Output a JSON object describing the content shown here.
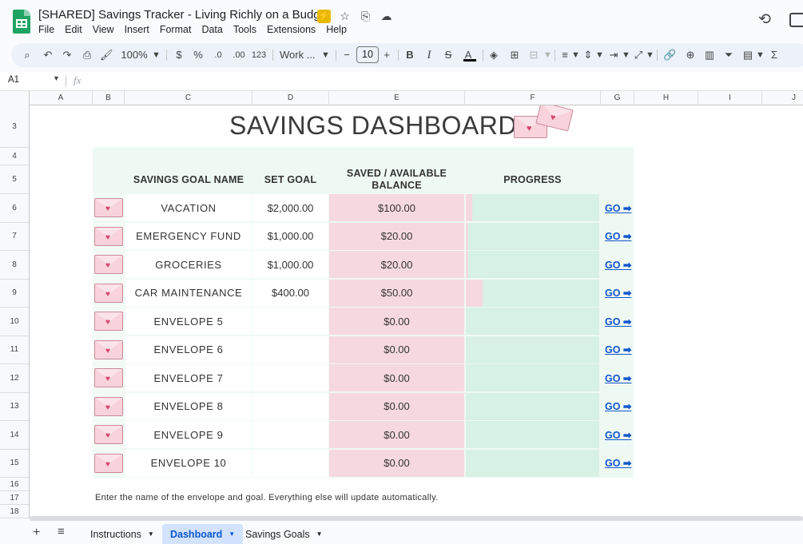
{
  "app": {
    "doc_title": "[SHARED] Savings Tracker - Living Richly on a Budget",
    "menu": [
      "File",
      "Edit",
      "View",
      "Insert",
      "Format",
      "Data",
      "Tools",
      "Extensions",
      "Help"
    ]
  },
  "toolbar": {
    "zoom": "100%",
    "currency": "$",
    "percent": "%",
    "dec_decrease": ".0",
    "dec_increase": ".00",
    "number_format": "123",
    "font": "Work ...",
    "font_size": "10",
    "minus": "−",
    "plus": "+",
    "bold": "B",
    "italic": "I",
    "strike": "S",
    "text_color": "A",
    "sigma": "Σ"
  },
  "formula_bar": {
    "cell_ref": "A1",
    "fx": "fx"
  },
  "grid": {
    "columns": [
      "A",
      "B",
      "C",
      "D",
      "E",
      "F",
      "G",
      "H",
      "I",
      "J"
    ],
    "rows": [
      "3",
      "4",
      "5",
      "6",
      "7",
      "8",
      "9",
      "10",
      "11",
      "12",
      "13",
      "14",
      "15",
      "16",
      "17",
      "18"
    ]
  },
  "dashboard": {
    "title": "SAVINGS DASHBOARD",
    "headers": {
      "name": "SAVINGS GOAL NAME",
      "goal": "SET GOAL",
      "saved": "SAVED / AVAILABLE BALANCE",
      "progress": "PROGRESS"
    },
    "rows": [
      {
        "name": "VACATION",
        "goal": "$2,000.00",
        "saved": "$100.00",
        "progress": 0.05,
        "go": "GO ➡"
      },
      {
        "name": "EMERGENCY FUND",
        "goal": "$1,000.00",
        "saved": "$20.00",
        "progress": 0.02,
        "go": "GO ➡"
      },
      {
        "name": "GROCERIES",
        "goal": "$1,000.00",
        "saved": "$20.00",
        "progress": 0.02,
        "go": "GO ➡"
      },
      {
        "name": "CAR MAINTENANCE",
        "goal": "$400.00",
        "saved": "$50.00",
        "progress": 0.125,
        "go": "GO ➡"
      },
      {
        "name": "ENVELOPE 5",
        "goal": "",
        "saved": "$0.00",
        "progress": 0,
        "go": "GO ➡"
      },
      {
        "name": "ENVELOPE 6",
        "goal": "",
        "saved": "$0.00",
        "progress": 0,
        "go": "GO ➡"
      },
      {
        "name": "ENVELOPE 7",
        "goal": "",
        "saved": "$0.00",
        "progress": 0,
        "go": "GO ➡"
      },
      {
        "name": "ENVELOPE 8",
        "goal": "",
        "saved": "$0.00",
        "progress": 0,
        "go": "GO ➡"
      },
      {
        "name": "ENVELOPE 9",
        "goal": "",
        "saved": "$0.00",
        "progress": 0,
        "go": "GO ➡"
      },
      {
        "name": "ENVELOPE 10",
        "goal": "",
        "saved": "$0.00",
        "progress": 0,
        "go": "GO ➡"
      }
    ],
    "footnote": "Enter the name of the envelope and goal. Everything else will update automatically."
  },
  "tabs": [
    {
      "label": "Instructions",
      "active": false
    },
    {
      "label": "Dashboard",
      "active": true
    },
    {
      "label": "Savings Goals",
      "active": false
    }
  ],
  "colors": {
    "pink": "#f6d9e0",
    "mint": "#d7f1e4",
    "link": "#1155cc",
    "sheets_green": "#1fa463"
  }
}
